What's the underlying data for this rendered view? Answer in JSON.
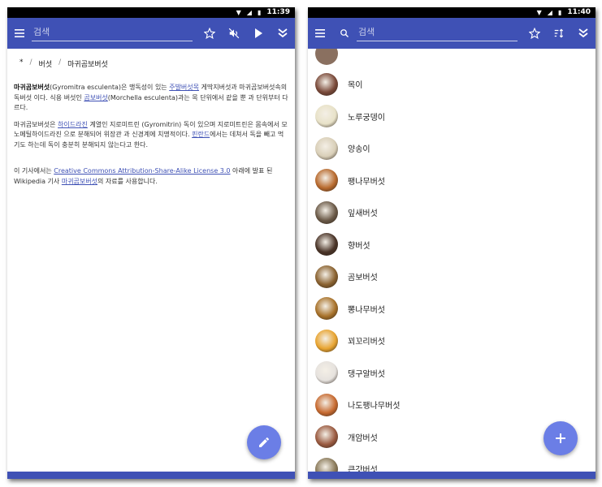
{
  "left_screen": {
    "status": {
      "time": "11:39"
    },
    "search": {
      "placeholder": "검색"
    },
    "breadcrumb": {
      "root": "*",
      "sep1": "/",
      "level1": "버섯",
      "sep2": "/",
      "level2": "마귀곰보버섯"
    },
    "article": {
      "p1": {
        "bold": "마귀곰보버섯",
        "t1": "(Gyromitra esculenta)은 맹독성이 있는 ",
        "link1": "주발버섯목",
        "t2": " 게딱지버섯과 마귀곰보버섯속의 독버섯 이다. 식용 버섯인 ",
        "link2": "곰보버섯",
        "t3": "(Morchella esculenta)과는 목 단위에서 같을 뿐 과 단위부터 다르다."
      },
      "p2": {
        "t1": "마귀곰보버섯은 ",
        "link1": "하이드라진",
        "t2": " 계열인 지로미트린 (Gyromitrin) 독이 있으며 지로미트린은 몸속에서 모노메틸하이드라진 으로 분해되어 위장관 과 신경계에 치명적이다. ",
        "link2": "핀란드",
        "t3": "에서는 데쳐서 독을 빼고 먹기도 하는데 독이 충분히 분해되지 않는다고 한다."
      },
      "p3": {
        "t1": "이 기사에서는 ",
        "link1": "Creative Commons Attribution-Share-Alike License 3.0",
        "t2": " 아래에 발표 된 Wikipedia 기사 ",
        "link2": "마귀곰보버섯",
        "t3": "의 자료를 사용합니다."
      }
    },
    "icons": {
      "menu": "menu-icon",
      "star": "star-outline-icon",
      "mute": "volume-off-icon",
      "play": "play-icon",
      "expand": "double-chevron-down-icon",
      "edit": "pencil-icon"
    }
  },
  "right_screen": {
    "status": {
      "time": "11:40"
    },
    "search": {
      "placeholder": "검색"
    },
    "items": [
      {
        "label": "목이",
        "color": "#7a4a3a"
      },
      {
        "label": "노루궁뎅이",
        "color": "#e8e2c8"
      },
      {
        "label": "양송이",
        "color": "#d9cfb8"
      },
      {
        "label": "팽나무버섯",
        "color": "#b86a2e"
      },
      {
        "label": "잎새버섯",
        "color": "#6b5a48"
      },
      {
        "label": "향버섯",
        "color": "#4a3428"
      },
      {
        "label": "곰보버섯",
        "color": "#8a6230"
      },
      {
        "label": "뽕나무버섯",
        "color": "#a8722a"
      },
      {
        "label": "꾀꼬리버섯",
        "color": "#e8a430"
      },
      {
        "label": "댕구알버섯",
        "color": "#e6e2de"
      },
      {
        "label": "나도팽나무버섯",
        "color": "#c76a30"
      },
      {
        "label": "개암버섯",
        "color": "#9a5a40"
      },
      {
        "label": "큰갓버섯",
        "color": "#8a7a5a"
      }
    ],
    "icons": {
      "menu": "menu-icon",
      "search": "search-icon",
      "star": "star-outline-icon",
      "sort": "sort-icon",
      "expand": "double-chevron-down-icon",
      "add": "plus-icon"
    }
  }
}
